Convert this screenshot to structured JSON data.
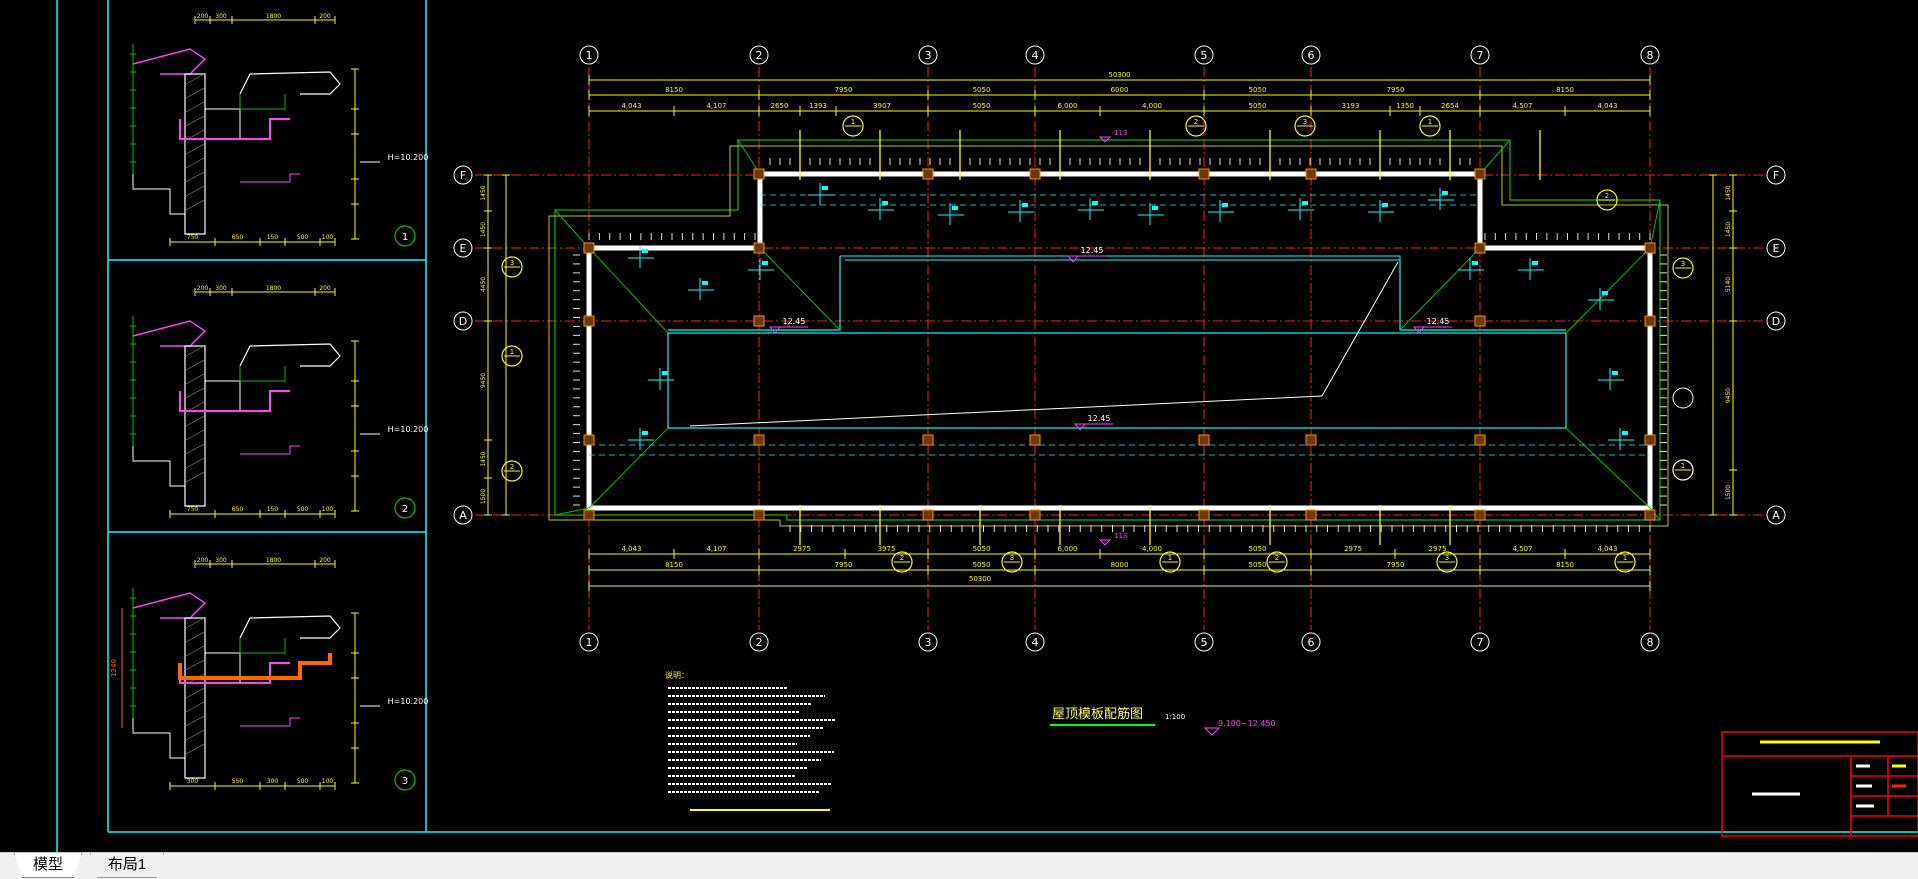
{
  "tabs": [
    {
      "label": "模型"
    },
    {
      "label": "布局1"
    }
  ],
  "plan": {
    "title": "屋顶模板配筋图",
    "scale": "1:100",
    "level_range": "9.100~12.450",
    "overall_dim": "50300",
    "col_axes": [
      "1",
      "2",
      "3",
      "4",
      "5",
      "6",
      "7",
      "8"
    ],
    "row_axes": [
      "F",
      "E",
      "D",
      "A"
    ],
    "top_spans": [
      "8150",
      "7950",
      "5050",
      "6000",
      "5050",
      "7950",
      "8150"
    ],
    "bottom_spans": [
      "8150",
      "7950",
      "5050",
      "8000",
      "5050",
      "7950",
      "8150"
    ],
    "top_sub": [
      "4,043",
      "4,107",
      "2650",
      "1393",
      "3907",
      "5050",
      "6,000",
      "4,000",
      "5050",
      "3193",
      "1350",
      "2654",
      "4,507",
      "4,043"
    ],
    "bottom_sub": [
      "4,043",
      "4,107",
      "2975",
      "3975",
      "5050",
      "6,000",
      "4,000",
      "5050",
      "2975",
      "2975",
      "4,507",
      "4,043"
    ],
    "left_dims": [
      "1450",
      "1450",
      "4450",
      "9450",
      "1450",
      "1500"
    ],
    "right_dims": [
      "1450",
      "1450",
      "5140",
      "9450",
      "1500"
    ],
    "elevation_main": "12.45",
    "elevation_sub": "12.45",
    "slope_mark": "113",
    "section_tags": [
      "1",
      "2",
      "3"
    ]
  },
  "details": [
    {
      "number": "1",
      "elevation": "H=10.200",
      "top_dims": [
        "200",
        "300",
        "1800",
        "200"
      ],
      "bottom_dims": [
        "750",
        "650",
        "150",
        "500",
        "100"
      ]
    },
    {
      "number": "2",
      "elevation": "H=10.200",
      "top_dims": [
        "200",
        "300",
        "1800",
        "200"
      ],
      "bottom_dims": [
        "750",
        "650",
        "150",
        "500",
        "100"
      ]
    },
    {
      "number": "3",
      "elevation": "H=10.200",
      "top_dims": [
        "200",
        "300",
        "1800",
        "200"
      ],
      "bottom_dims": [
        "300",
        "550",
        "300",
        "500",
        "100"
      ],
      "side_dim": "1240"
    }
  ],
  "notes_heading": "说明：",
  "colors": {
    "axis": "#ff2020",
    "dim": "#ffff00",
    "slab": "#ffffff",
    "beam": "#00c000",
    "rebar": "#00ffff",
    "frame": "#00ffff",
    "detail_pink": "#ff40ff",
    "detail_orange": "#ff6a00"
  }
}
